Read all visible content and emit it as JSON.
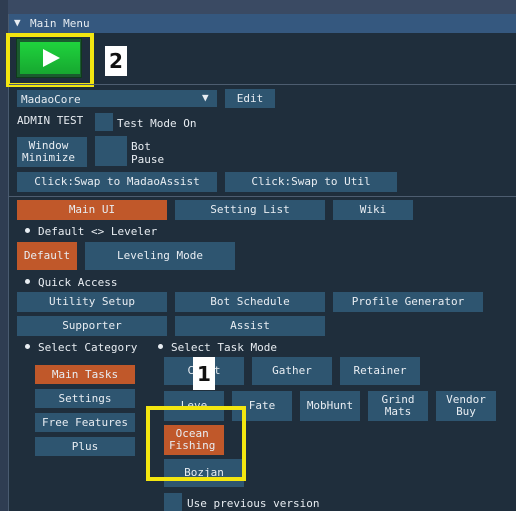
{
  "window": {
    "title": "Main Menu"
  },
  "top": {
    "dropdown_value": "MadaoCore",
    "edit_label": "Edit",
    "admin_test_label": "ADMIN TEST",
    "test_mode_label": "Test Mode On",
    "window_minimize_label": "Window\nMinimize",
    "bot_pause_label": "Bot\nPause",
    "swap_madaoassist_label": "Click:Swap to MadaoAssist",
    "swap_util_label": "Click:Swap to Util"
  },
  "tabs": [
    {
      "label": "Main UI",
      "active": true
    },
    {
      "label": "Setting List",
      "active": false
    },
    {
      "label": "Wiki",
      "active": false
    }
  ],
  "leveler": {
    "header": "Default <> Leveler",
    "default_label": "Default",
    "leveling_mode_label": "Leveling Mode"
  },
  "quick_access": {
    "header": "Quick Access",
    "items": [
      "Utility Setup",
      "Bot Schedule",
      "Profile Generator",
      "Supporter",
      "Assist"
    ]
  },
  "category": {
    "header": "Select Category",
    "items": [
      "Main Tasks",
      "Settings",
      "Free Features",
      "Plus"
    ]
  },
  "task_mode": {
    "header": "Select Task Mode",
    "items": [
      "Craft",
      "Gather",
      "Retainer",
      "Leve",
      "Fate",
      "MobHunt",
      "Grind\nMats",
      "Vendor\nBuy",
      "Ocean\nFishing",
      "Bozjan"
    ]
  },
  "bottom": {
    "use_previous_label": "Use previous version"
  },
  "annotations": {
    "badge_1": "1",
    "badge_2": "2"
  },
  "colors": {
    "accent_active": "#c0582a",
    "button": "#2e5570",
    "play_green": "#1fd33d",
    "highlight": "#f3e610"
  },
  "icons": [
    "triangle-down-icon",
    "play-icon"
  ]
}
